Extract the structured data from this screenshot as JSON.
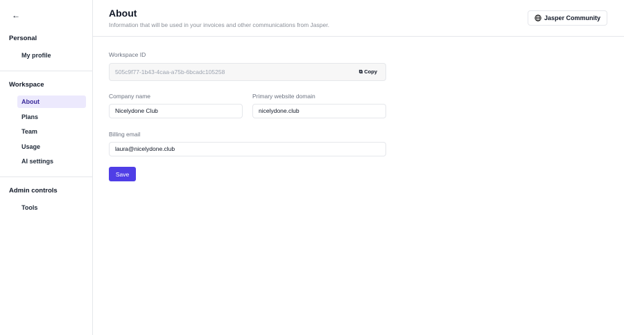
{
  "sidebar": {
    "sections": [
      {
        "title": "Personal",
        "items": [
          "My profile"
        ]
      },
      {
        "title": "Workspace",
        "items": [
          "About",
          "Plans",
          "Team",
          "Usage",
          "AI settings"
        ]
      },
      {
        "title": "Admin controls",
        "items": [
          "Tools"
        ]
      }
    ]
  },
  "header": {
    "title": "About",
    "subtitle": "Information that will be used in your invoices and other communications from Jasper.",
    "community_button": "Jasper Community"
  },
  "form": {
    "workspace_id_label": "Workspace ID",
    "workspace_id": "505c9f77-1b43-4caa-a75b-6bcadc105258",
    "copy_label": "Copy",
    "company_label": "Company name",
    "company_value": "Nicelydone Club",
    "domain_label": "Primary website domain",
    "domain_value": "nicelydone.club",
    "billing_label": "Billing email",
    "billing_value": "laura@nicelydone.club",
    "save_label": "Save"
  },
  "colors": {
    "accent": "#4f3ee6",
    "active_bg": "#ece9fd"
  }
}
